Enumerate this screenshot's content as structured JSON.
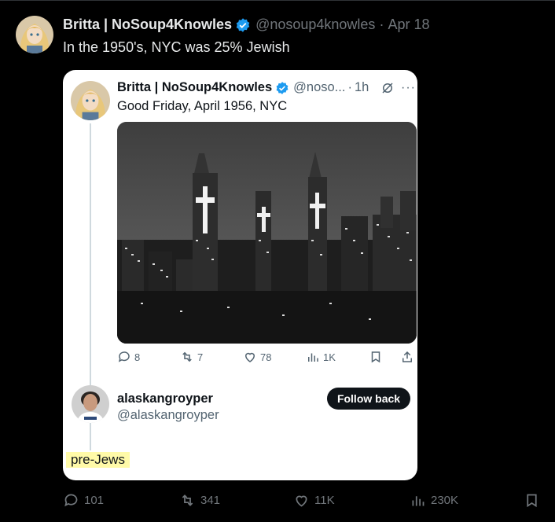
{
  "main_tweet": {
    "author_name": "Britta | NoSoup4Knowles",
    "handle": "@nosoup4knowles",
    "separator": "·",
    "date": "Apr 18",
    "text": "In the 1950's, NYC was 25% Jewish"
  },
  "quoted": {
    "first": {
      "author_name": "Britta | NoSoup4Knowles",
      "handle": "@noso...",
      "separator": "·",
      "time": "1h",
      "text": "Good Friday, April 1956, NYC",
      "image_alt": "Black-and-white photo of New York City skyline at night with illuminated crosses on skyscrapers",
      "actions": {
        "replies": "8",
        "reposts": "7",
        "likes": "78",
        "views": "1K"
      }
    },
    "second": {
      "author_name": "alaskangroyper",
      "handle": "@alaskangroyper",
      "follow_label": "Follow back",
      "text": "pre-Jews"
    }
  },
  "bottom_actions": {
    "replies": "101",
    "reposts": "341",
    "likes": "11K",
    "views": "230K"
  },
  "colors": {
    "background": "#000000",
    "verified": "#1d9bf0",
    "muted": "#71767b",
    "highlight": "#fffaa8"
  },
  "icons": [
    "verified-badge-icon",
    "grok-icon",
    "more-icon",
    "reply-icon",
    "repost-icon",
    "like-icon",
    "views-icon",
    "bookmark-icon",
    "share-icon"
  ]
}
